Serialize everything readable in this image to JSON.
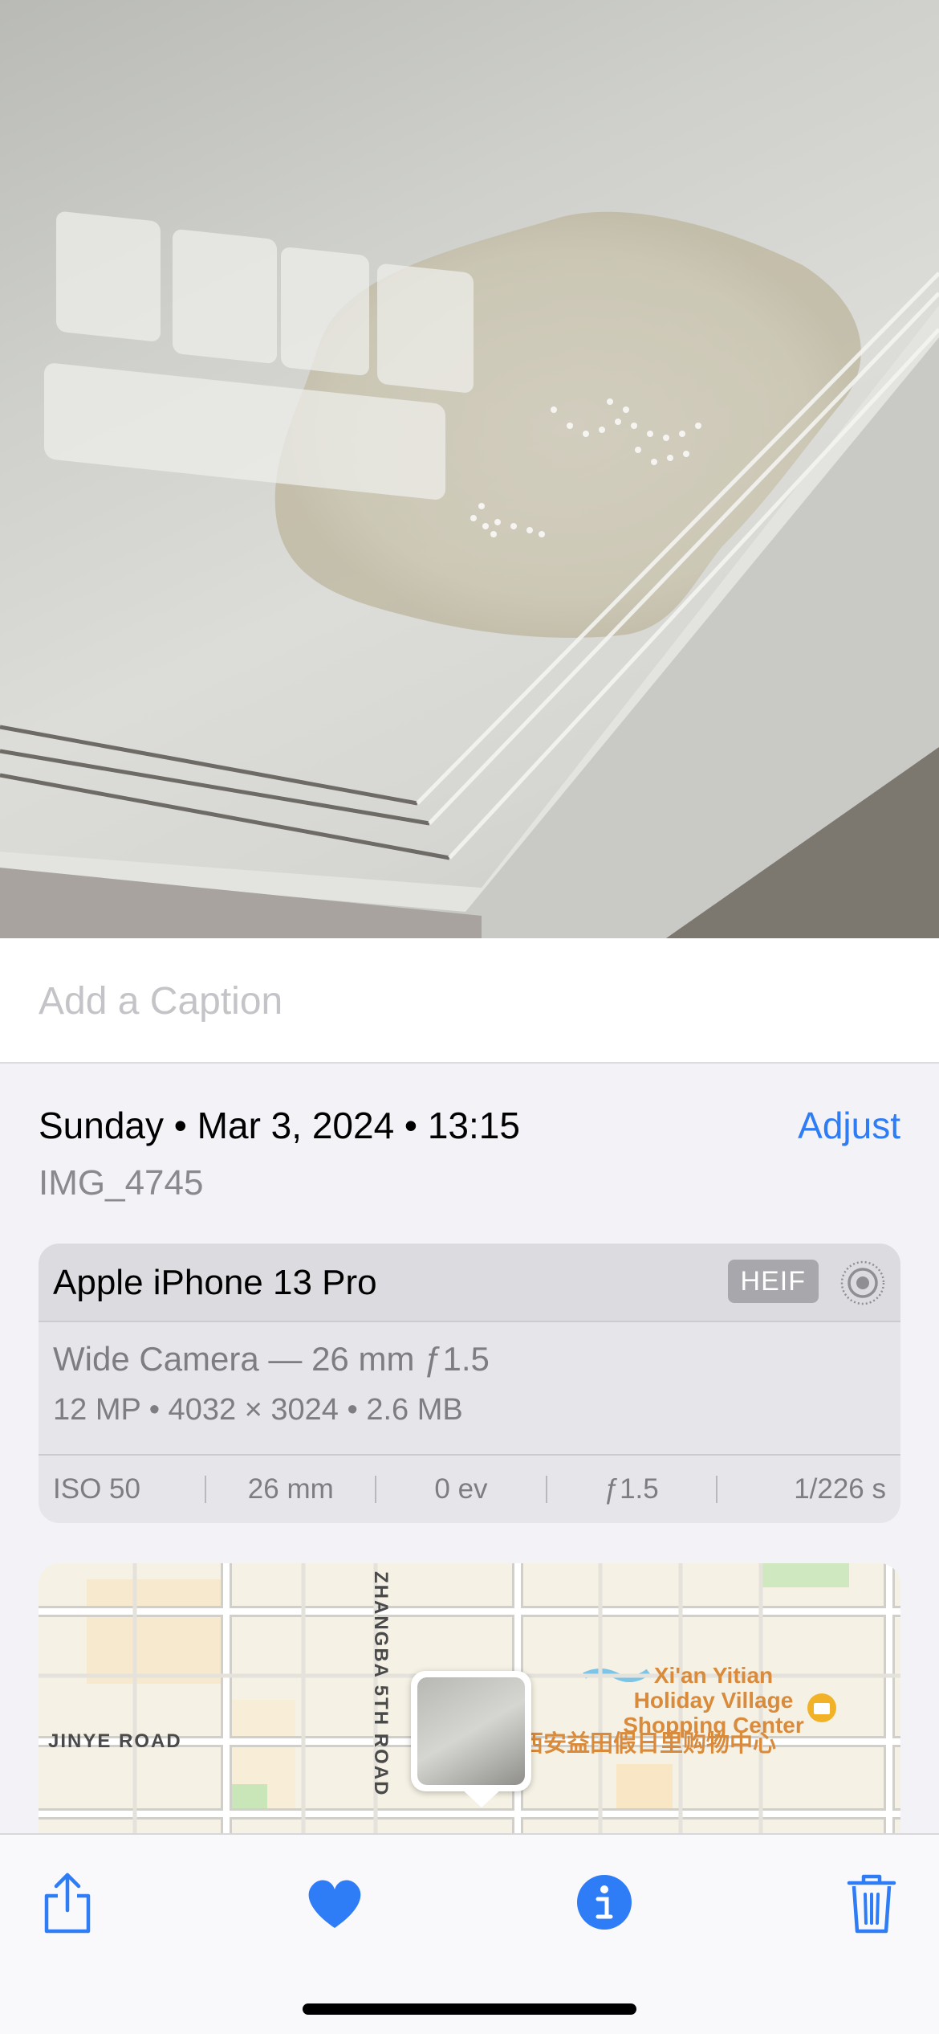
{
  "caption": {
    "placeholder": "Add a Caption"
  },
  "info": {
    "date_line": "Sunday • Mar 3, 2024 • 13:15",
    "adjust_label": "Adjust",
    "filename": "IMG_4745"
  },
  "camera": {
    "device": "Apple iPhone 13 Pro",
    "format_badge": "HEIF",
    "lens": "Wide Camera — 26 mm ƒ1.5",
    "specs": "12 MP  •  4032 × 3024  •  2.6 MB",
    "exif": [
      "ISO 50",
      "26 mm",
      "0 ev",
      "ƒ1.5",
      "1/226 s"
    ]
  },
  "map": {
    "road_vertical": "ZHANGBA 5TH ROAD",
    "road_horizontal": "JINYE ROAD",
    "poi_name_en": "Xi'an Yitian\nHoliday Village\nShopping Center",
    "poi_name_cn": "西安益田假日里购物中心"
  },
  "toolbar": {
    "share_icon": "share-icon",
    "favorite_icon": "heart-icon",
    "info_icon": "info-icon",
    "delete_icon": "trash-icon"
  },
  "colors": {
    "accent": "#2f7df6",
    "poi": "#d98a3a"
  }
}
